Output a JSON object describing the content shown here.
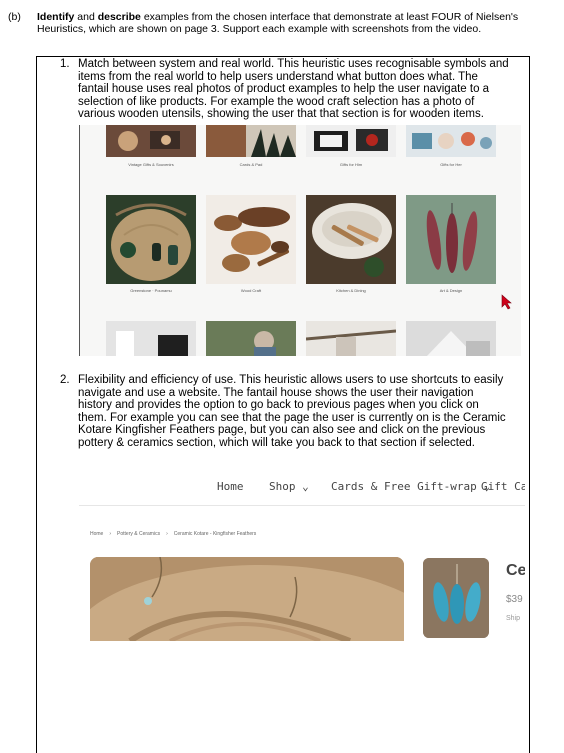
{
  "question": {
    "label": "(b)",
    "bold1": "Identify",
    "mid1": " and ",
    "bold2": "describe",
    "rest": " examples from the chosen interface that demonstrate at least FOUR of Nielsen's Heuristics, which are shown on page 3. Support each example with screenshots from the video."
  },
  "answers": [
    {
      "number": "1.",
      "text": "Match between system and real world. This heuristic uses recognisable symbols and items from the real world to help users understand what button does what. The fantail house uses real photos of product examples to help the user navigate to a selection of like products. For example the wood craft selection has a photo of various wooden utensils, showing the user that that section is for wooden items."
    },
    {
      "number": "2.",
      "text": "Flexibility and efficiency of use. This heuristic allows users to use shortcuts to easily navigate and use a website. The fantail house shows the user their navigation history and provides the option to go back to previous pages when you click on them. For example you can see that the page the user is currently on is the Ceramic Kotare Kingfisher Feathers page, but you can also see and click on the previous pottery & ceramics section, which will take you back to that section if selected."
    }
  ],
  "screenshot1": {
    "top_captions": [
      "Vintage Gifts & Souvenirs",
      "Cards & Pad",
      "Gifts for Him",
      "Gifts for Her"
    ],
    "mid_captions": [
      "Greenstone · Pounamu",
      "Wood Craft",
      "Kitchen & Dining",
      "Art & Design"
    ]
  },
  "screenshot2": {
    "nav": {
      "home": "Home",
      "shop": "Shop ⌄",
      "cards": "Cards & Free Gift-wrap ⌄",
      "gift": "Gift Card"
    },
    "breadcrumb": [
      "Home",
      "›",
      "Pottery & Ceramics",
      "›",
      "Ceramic Kotare - Kingfisher Feathers"
    ],
    "product_title": "Ce",
    "product_price": "$39",
    "product_ship": "Ship"
  },
  "colors": {
    "page_bg": "#ffffff",
    "shot1_bg": "#f7f7f6",
    "cursor": "#d0021b"
  }
}
